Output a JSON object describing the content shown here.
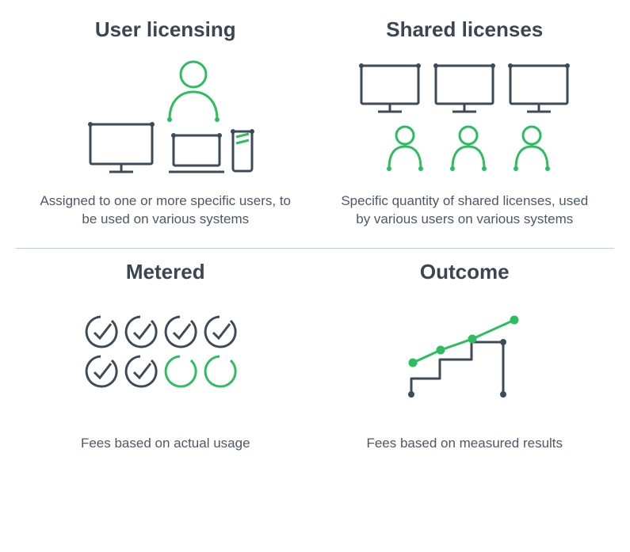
{
  "colors": {
    "stroke_dark": "#3d4a57",
    "stroke_green": "#2bbd5f"
  },
  "items": [
    {
      "title": "User licensing",
      "desc": "Assigned to one or more specific users, to be used on various systems"
    },
    {
      "title": "Shared licenses",
      "desc": "Specific quantity of shared licenses, used by various users on various systems"
    },
    {
      "title": "Metered",
      "desc": "Fees based on actual usage"
    },
    {
      "title": "Outcome",
      "desc": "Fees based on measured results"
    }
  ]
}
